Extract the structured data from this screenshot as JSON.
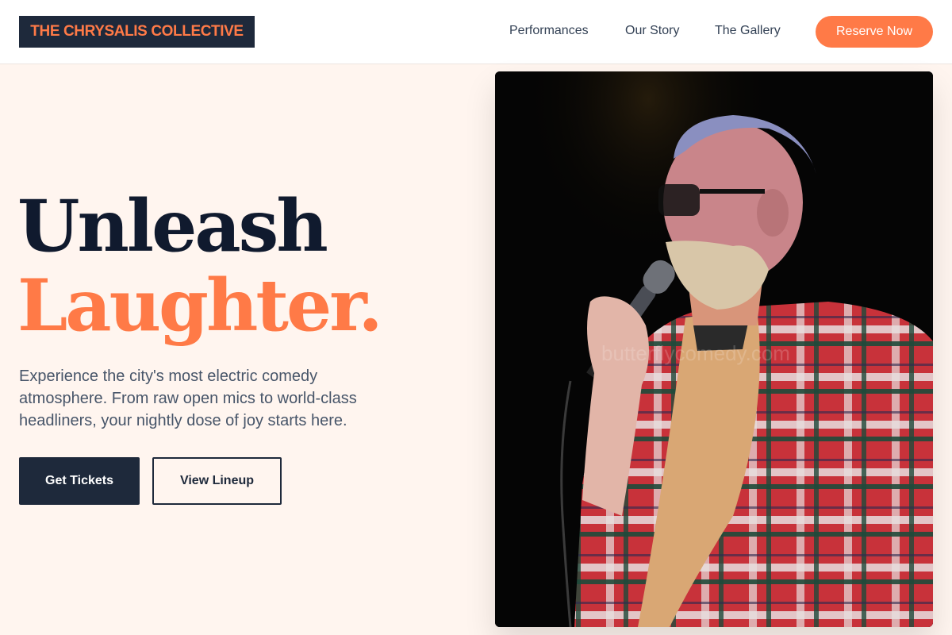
{
  "header": {
    "logo": "THE CHRYSALIS COLLECTIVE",
    "nav": [
      "Performances",
      "Our Story",
      "The Gallery"
    ],
    "cta": "Reserve Now"
  },
  "hero": {
    "title_line1": "Unleash",
    "title_line2": "Laughter.",
    "description": "Experience the city's most electric comedy atmosphere. From raw open mics to world-class headliners, your nightly dose of joy starts here.",
    "primary_button": "Get Tickets",
    "secondary_button": "View Lineup"
  },
  "image": {
    "watermark": "butterflycomedy.com",
    "subject": "comedian-with-microphone-photo"
  },
  "colors": {
    "accent": "#ff7a47",
    "navy": "#1e293b",
    "background": "#fff5ef"
  }
}
